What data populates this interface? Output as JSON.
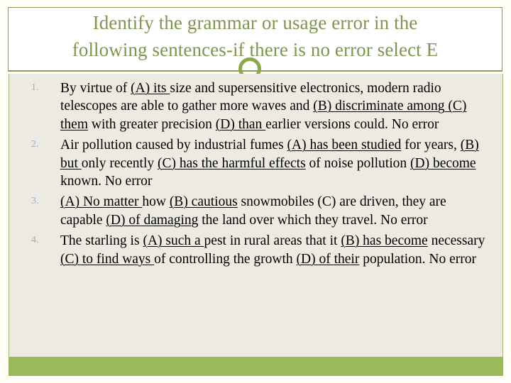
{
  "slide": {
    "background_color": "#FFFEF7",
    "accent_color": "#8CA64A",
    "title_color": "#7F9550",
    "content_background": "#EDEBE1",
    "footer_color": "#9AB85C",
    "number_color": "#9BB0C6"
  },
  "header": {
    "title": "Identify the grammar or usage error in the\nfollowing sentences-if there is no error select E",
    "ring_icon": "circle-outline-icon",
    "divider": "header-divider"
  },
  "questions": [
    {
      "number": "1.",
      "text": "By virtue of (A) its size and supersensitive electronics, modern radio telescopes are able to gather more waves and (B) discriminate among (C) them with greater precision (D) than earlier versions could. No error",
      "segments": [
        {
          "text": "By virtue of ",
          "underline": false
        },
        {
          "text": "(A) its ",
          "underline": true
        },
        {
          "text": "size and supersensitive electronics, modern radio telescopes are able to gather more waves and ",
          "underline": false
        },
        {
          "text": "(B) discriminate among (C) them",
          "underline": true
        },
        {
          "text": " with greater precision ",
          "underline": false
        },
        {
          "text": "(D) than ",
          "underline": true
        },
        {
          "text": "earlier versions could. No error",
          "underline": false
        }
      ]
    },
    {
      "number": "2.",
      "text": "Air pollution caused by industrial fumes (A) has been studied for years, (B) but only recently (C) has the harmful effects of noise pollution (D) become known. No error",
      "segments": [
        {
          "text": "Air pollution caused by industrial fumes ",
          "underline": false
        },
        {
          "text": "(A) has been studied",
          "underline": true
        },
        {
          "text": " for years, ",
          "underline": false
        },
        {
          "text": "(B) but ",
          "underline": true
        },
        {
          "text": "only recently ",
          "underline": false
        },
        {
          "text": "(C) has the harmful effects",
          "underline": true
        },
        {
          "text": " of noise pollution ",
          "underline": false
        },
        {
          "text": "(D) become ",
          "underline": true
        },
        {
          "text": "known. No error",
          "underline": false
        }
      ]
    },
    {
      "number": "3.",
      "text": "(A) No matter how (B) cautious snowmobiles (C) are driven, they are capable (D) of damaging the land over which they travel. No error",
      "segments": [
        {
          "text": "(A) No matter ",
          "underline": true
        },
        {
          "text": "how ",
          "underline": false
        },
        {
          "text": "(B) cautious",
          "underline": true
        },
        {
          "text": " snowmobiles (C) are driven, they are capable ",
          "underline": false
        },
        {
          "text": "(D) of damaging",
          "underline": true
        },
        {
          "text": " the land over which they travel. No error",
          "underline": false
        }
      ]
    },
    {
      "number": "4.",
      "text": "The starling is (A) such a pest in rural areas that it (B) has become necessary (C) to find ways of controlling the growth (D) of their population. No error",
      "segments": [
        {
          "text": "The starling is ",
          "underline": false
        },
        {
          "text": "(A) such a ",
          "underline": true
        },
        {
          "text": "pest in rural areas that it ",
          "underline": false
        },
        {
          "text": "(B) has become",
          "underline": true
        },
        {
          "text": " necessary ",
          "underline": false
        },
        {
          "text": "(C) to find ways ",
          "underline": true
        },
        {
          "text": "of controlling the growth ",
          "underline": false
        },
        {
          "text": "(D) of their",
          "underline": true
        },
        {
          "text": " population. No error",
          "underline": false
        }
      ]
    }
  ]
}
